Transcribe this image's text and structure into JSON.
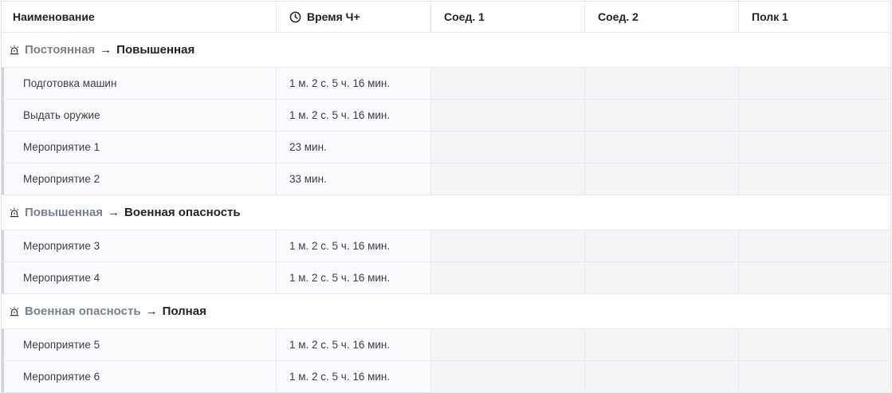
{
  "columns": {
    "name": "Наименование",
    "time": "Время Ч+",
    "conn1": "Соед. 1",
    "conn2": "Соед. 2",
    "regiment1": "Полк 1"
  },
  "groups": [
    {
      "from": "Постоянная",
      "to": "Повышенная",
      "rows": [
        {
          "name": "Подготовка машин",
          "time": "1 м. 2 с. 5 ч. 16 мин."
        },
        {
          "name": "Выдать оружие",
          "time": "1 м. 2 с. 5 ч. 16 мин."
        },
        {
          "name": "Мероприятие 1",
          "time": "23 мин."
        },
        {
          "name": "Мероприятие 2",
          "time": "33 мин."
        }
      ]
    },
    {
      "from": "Повышенная",
      "to": "Военная опасность",
      "rows": [
        {
          "name": "Мероприятие 3",
          "time": "1 м. 2 с. 5 ч. 16 мин."
        },
        {
          "name": "Мероприятие 4",
          "time": "1 м. 2 с. 5 ч. 16 мин."
        }
      ]
    },
    {
      "from": "Военная опасность",
      "to": "Полная",
      "rows": [
        {
          "name": "Мероприятие 5",
          "time": "1 м. 2 с. 5 ч. 16 мин."
        },
        {
          "name": "Мероприятие 6",
          "time": "1 м. 2 с. 5 ч. 16 мин."
        }
      ]
    }
  ],
  "arrow_glyph": "→",
  "icons": {
    "time_column": "clock-icon",
    "group": "siren-icon"
  },
  "colors": {
    "group_from": "#7a828d",
    "row_bg": "#f4f5f7",
    "row_accent": "#cfd3d9"
  }
}
